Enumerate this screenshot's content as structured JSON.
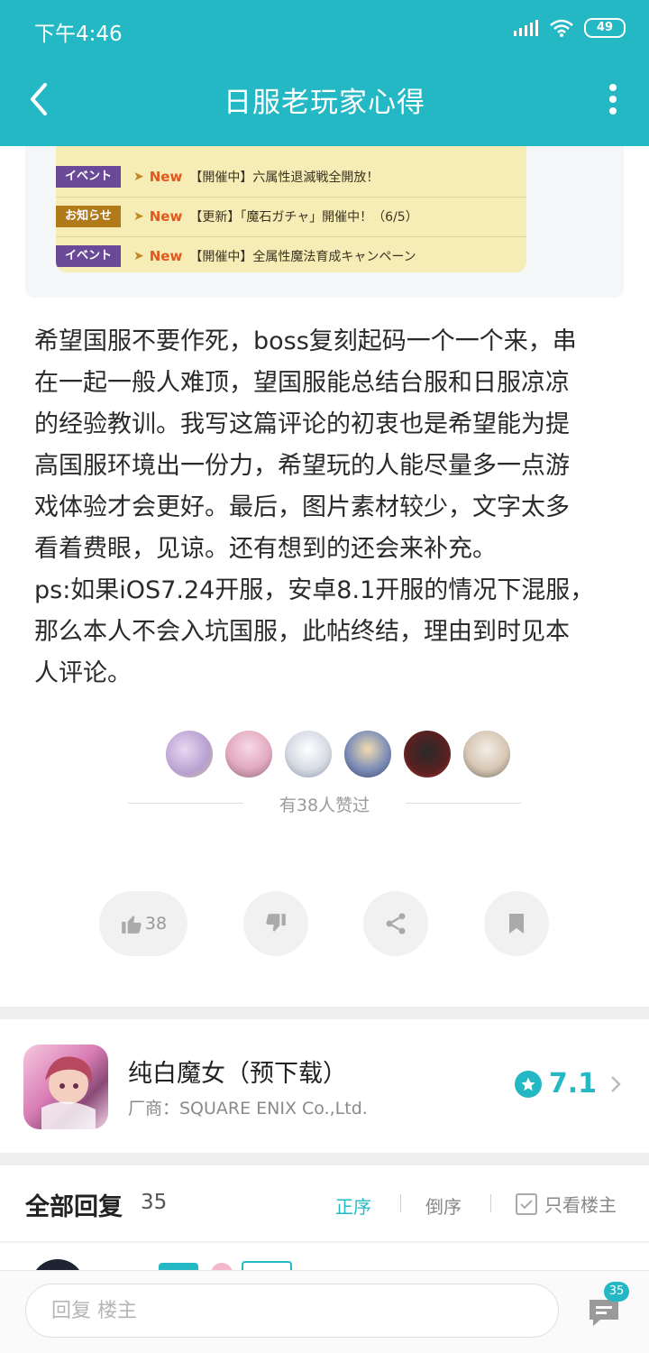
{
  "status_bar": {
    "time": "下午4:46",
    "battery": "49"
  },
  "nav": {
    "title": "日服老玩家心得"
  },
  "banner": {
    "rows": [
      {
        "tag": "イベント",
        "new": "New",
        "text": "【開催中】六属性退滅戦全開放！"
      },
      {
        "tag": "お知らせ",
        "new": "New",
        "text": "【更新】「魔石ガチャ」開催中！（6/5）"
      },
      {
        "tag": "イベント",
        "new": "New",
        "text": "【開催中】全属性魔法育成キャンペーン"
      }
    ]
  },
  "article": {
    "lines": [
      "希望国服不要作死，boss复刻起码一个一个来，串",
      "在一起一般人难顶，望国服能总结台服和日服凉凉",
      "的经验教训。我写这篇评论的初衷也是希望能为提",
      "高国服环境出一份力，希望玩的人能尽量多一点游",
      "戏体验才会更好。最后，图片素材较少，文字太多",
      "看着费眼，见谅。还有想到的还会来补充。",
      "ps:如果iOS7.24开服，安卓8.1开服的情况下混服，",
      "那么本人不会入坑国服，此帖终结，理由到时见本",
      "人评论。"
    ]
  },
  "likes": {
    "text": "有38人赞过"
  },
  "actions": {
    "like_count": "38"
  },
  "game": {
    "name": "纯白魔女（预下载）",
    "vendor": "厂商：SQUARE ENIX Co.,Ltd.",
    "rating": "7.1"
  },
  "replies": {
    "title": "全部回复",
    "count": "35",
    "sort_asc": "正序",
    "sort_desc": "倒序",
    "only_op": "只看楼主"
  },
  "bottom": {
    "placeholder": "回复  楼主",
    "comment_badge": "35"
  }
}
